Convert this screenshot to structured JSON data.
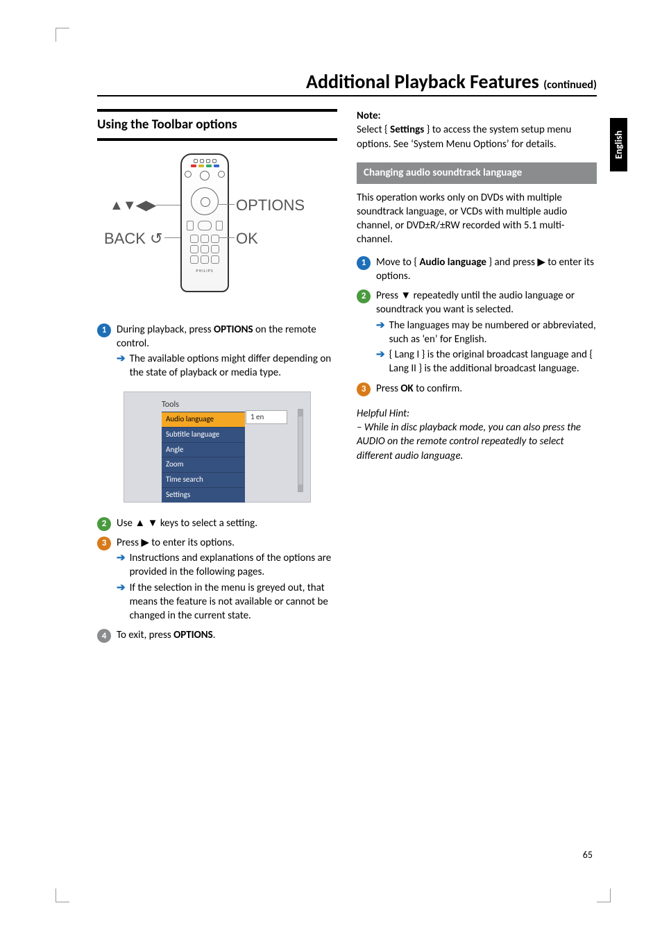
{
  "page": {
    "title_main": "Additional Playback Features ",
    "title_cont": "(continued)",
    "lang_tab": "English",
    "page_number": "65"
  },
  "left": {
    "section_title": "Using the Toolbar options",
    "diagram": {
      "nav_label": "▲▼◀▶",
      "back_label": "BACK ↺",
      "options_label": "OPTIONS",
      "ok_label": "OK",
      "brand": "PHILIPS"
    },
    "step1": {
      "text_a": "During playback, press ",
      "bold_a": "OPTIONS",
      "text_b": " on the remote control.",
      "arrow_text": "The available options might differ depending on the state of playback or media type."
    },
    "tools": {
      "title": "Tools",
      "items": [
        "Audio language",
        "Subtitle language",
        "Angle",
        "Zoom",
        "Time search",
        "Settings"
      ],
      "selected_value": "1 en"
    },
    "step2": {
      "text": "Use ▲ ▼ keys to select a setting."
    },
    "step3": {
      "text": "Press ▶ to enter its options.",
      "arrow1": "Instructions and explanations of the options are provided in the following pages.",
      "arrow2": "If the selection in the menu is greyed out, that means the feature is not available or cannot be changed in the current state."
    },
    "step4": {
      "text_a": "To exit, press ",
      "bold_a": "OPTIONS",
      "text_b": "."
    }
  },
  "right": {
    "note": {
      "head": "Note:",
      "text_a": "Select { ",
      "bold_a": "Settings",
      "text_b": " } to access the system setup menu options.  See ‘System Menu Options’ for details."
    },
    "subhead": "Changing audio soundtrack language",
    "intro": "This operation works only on DVDs with multiple soundtrack language, or VCDs with multiple audio channel, or DVD±R/±RW recorded with 5.1 multi-channel.",
    "step1": {
      "text_a": "Move to { ",
      "bold_a": "Audio language",
      "text_b": " } and press ▶ to enter its options."
    },
    "step2": {
      "text": "Press ▼ repeatedly until the audio language or soundtrack you want is selected.",
      "arrow1": "The languages may be numbered or abbreviated, such as ‘en’ for English.",
      "arrow2": "{ Lang I } is the original broadcast language and { Lang II } is the additional broadcast language."
    },
    "step3": {
      "text_a": "Press ",
      "bold_a": "OK",
      "text_b": " to confirm."
    },
    "hint": {
      "head": "Helpful Hint:",
      "body": "–  While in disc playback mode, you can also press the AUDIO on the remote control repeatedly to select different audio language."
    }
  }
}
